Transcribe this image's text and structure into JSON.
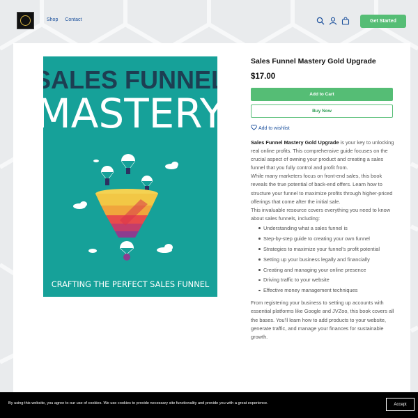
{
  "header": {
    "nav": [
      "Shop",
      "Contact"
    ],
    "cta_label": "Get Started"
  },
  "product": {
    "title": "Sales Funnel Mastery Gold Upgrade",
    "price": "$17.00",
    "add_to_cart": "Add to Cart",
    "buy_now": "Buy Now",
    "wishlist": "Add to wishlist",
    "cover": {
      "line1": "SALES FUNNEL",
      "line2": "MASTERY",
      "tagline": "CRAFTING THE PERFECT SALES FUNNEL"
    },
    "description": {
      "p1_bold": "Sales Funnel Mastery Gold Upgrade",
      "p1_rest": " is your key to unlocking real online profits. This comprehensive guide focuses on the crucial aspect of owning your product and creating a sales funnel that you fully control and profit from.",
      "p2": "While many marketers focus on front-end sales, this book reveals the true potential of back-end offers. Learn how to structure your funnel to maximize profits through higher-priced offerings that come after the initial sale.",
      "p3": "This invaluable resource covers everything you need to know about sales funnels, including:",
      "bullets": [
        "Understanding what a sales funnel is",
        "Step-by-step guide to creating your own funnel",
        "Strategies to maximize your funnel's profit potential",
        "Setting up your business legally and financially",
        "Creating and managing your online presence",
        "Driving traffic to your website",
        "Effective money management techniques"
      ],
      "p4": "From registering your business to setting up accounts with essential platforms like Google and JVZoo, this book covers all the bases. You'll learn how to add products to your website, generate traffic, and manage your finances for sustainable growth."
    }
  },
  "cookie": {
    "text": "By using this website, you agree to our use of cookies. We use cookies to provide necessary site functionality and provide you with a great experience.",
    "accept": "Accept"
  },
  "colors": {
    "accent": "#55bd75",
    "link": "#1a4f9c",
    "cover_bg": "#16a199",
    "cover_title_dark": "#1d3e52"
  },
  "icons": [
    "search-icon",
    "user-icon",
    "cart-icon",
    "heart-icon"
  ]
}
